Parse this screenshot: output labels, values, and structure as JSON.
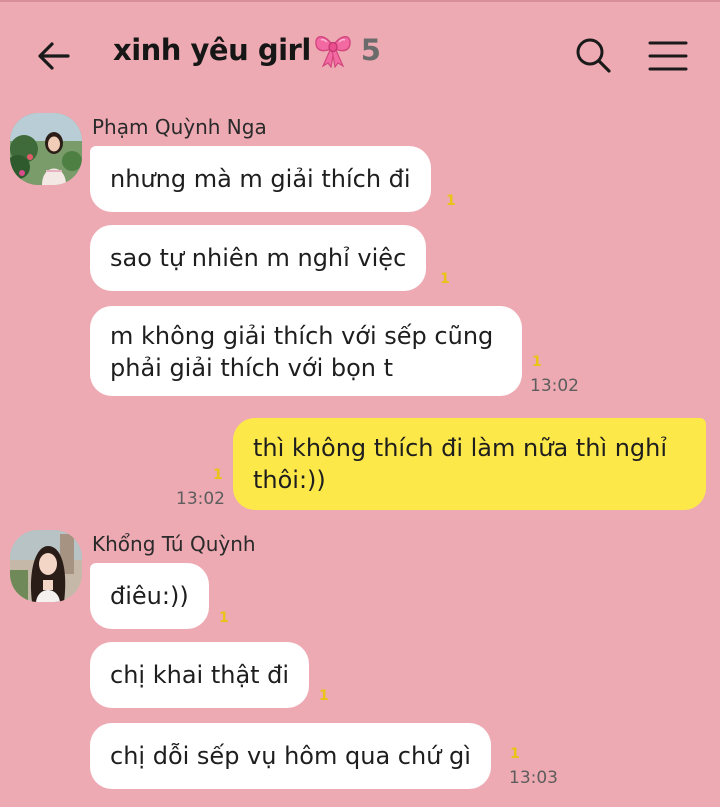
{
  "header": {
    "title": "xinh yêu girl",
    "member_count": "5"
  },
  "colors": {
    "background": "#eeaab3",
    "my_bubble": "#fde84a",
    "other_bubble": "#ffffff",
    "unread": "#e9c316"
  },
  "icons": {
    "back": "arrow-left-icon",
    "bow": "ribbon-bow-icon",
    "search": "search-icon",
    "menu": "hamburger-menu-icon"
  },
  "messages": [
    {
      "sender": "Phạm Quỳnh Nga",
      "text": "nhưng mà m giải thích đi",
      "unread": "1"
    },
    {
      "text": "sao tự nhiên m nghỉ việc",
      "unread": "1"
    },
    {
      "text_line1": "m không giải thích với sếp cũng",
      "text_line2": "phải giải thích với bọn t",
      "unread": "1",
      "time": "13:02"
    },
    {
      "mine": true,
      "text_line1": "thì không thích đi làm nữa thì  nghỉ",
      "text_line2": "thôi:))",
      "unread": "1",
      "time": "13:02"
    },
    {
      "sender": "Khổng Tú Quỳnh",
      "text": "điêu:))",
      "unread": "1"
    },
    {
      "text": "chị khai thật đi",
      "unread": "1"
    },
    {
      "text": "chị dỗi sếp vụ hôm qua chứ gì",
      "unread": "1",
      "time": "13:03"
    }
  ]
}
